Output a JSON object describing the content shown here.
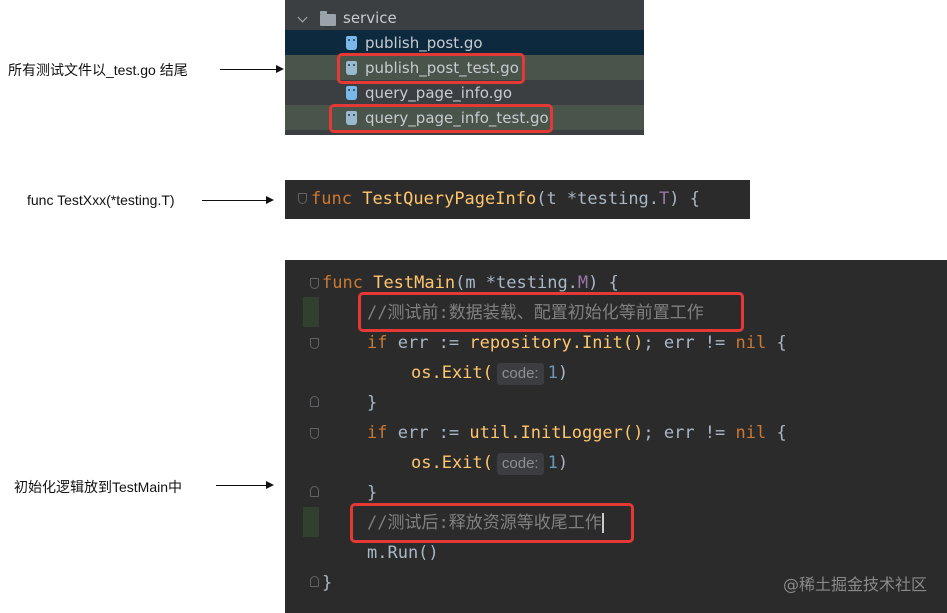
{
  "annotations": {
    "test_file": "所有测试文件以_test.go 结尾",
    "test_func": "func TestXxx(*testing.T)",
    "test_main": "初始化逻辑放到TestMain中"
  },
  "file_tree": {
    "folder": "service",
    "files": [
      {
        "name": "publish_post.go"
      },
      {
        "name": "publish_post_test.go"
      },
      {
        "name": "query_page_info.go"
      },
      {
        "name": "query_page_info_test.go"
      }
    ]
  },
  "code1": {
    "kw_func": "func",
    "name": "TestQueryPageInfo",
    "open": "(t *testing.",
    "type": "T",
    "close": ") {"
  },
  "code2": {
    "kw_func": "func",
    "name": "TestMain",
    "sig_a": "(m *testing.",
    "sig_type": "M",
    "sig_b": ") {",
    "comment1": "//测试前:数据装载、配置初始化等前置工作",
    "kw_if": "if",
    "err_assign": " err := ",
    "repo_init": "repository.Init()",
    "err_check": "; err != ",
    "kw_nil": "nil",
    "brace_open": " {",
    "os_exit": "os.Exit(",
    "hint_label": "code:",
    "one": "1",
    "paren_close": ")",
    "brace_close": "}",
    "util_init": "util.InitLogger()",
    "comment2": "//测试后:释放资源等收尾工作",
    "run": "m.Run()",
    "final_brace": "}"
  },
  "watermark": "@稀土掘金技术社区",
  "colors": {
    "editor_bg": "#2b2b2b",
    "tree_bg": "#3c3f41",
    "keyword": "#cc7832",
    "function": "#ffc66d",
    "highlight_box": "#e53935"
  }
}
